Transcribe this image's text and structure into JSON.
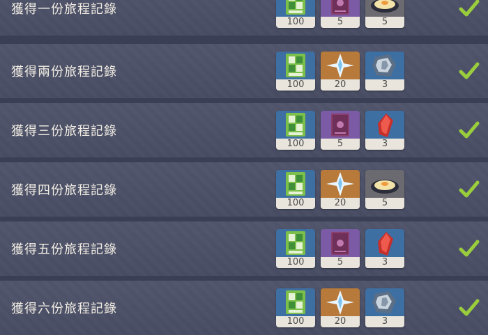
{
  "rows": [
    {
      "title": "獲得一份旅程記錄",
      "completed": true,
      "rewards": [
        {
          "icon": "battle-pass-exp-icon",
          "count": "100"
        },
        {
          "icon": "heros-wit-book-icon",
          "count": "5"
        },
        {
          "icon": "fragile-resin-plate-icon",
          "count": "5"
        }
      ]
    },
    {
      "title": "獲得兩份旅程記錄",
      "completed": true,
      "rewards": [
        {
          "icon": "battle-pass-exp-icon",
          "count": "100"
        },
        {
          "icon": "primogem-icon",
          "count": "20"
        },
        {
          "icon": "mystic-enhancement-ore-icon",
          "count": "3"
        }
      ]
    },
    {
      "title": "獲得三份旅程記錄",
      "completed": true,
      "rewards": [
        {
          "icon": "battle-pass-exp-icon",
          "count": "100"
        },
        {
          "icon": "heros-wit-book-icon",
          "count": "5"
        },
        {
          "icon": "red-crystal-material-icon",
          "count": "3"
        }
      ]
    },
    {
      "title": "獲得四份旅程記錄",
      "completed": true,
      "rewards": [
        {
          "icon": "battle-pass-exp-icon",
          "count": "100"
        },
        {
          "icon": "primogem-icon",
          "count": "20"
        },
        {
          "icon": "fragile-resin-plate-icon",
          "count": "5"
        }
      ]
    },
    {
      "title": "獲得五份旅程記錄",
      "completed": true,
      "rewards": [
        {
          "icon": "battle-pass-exp-icon",
          "count": "100"
        },
        {
          "icon": "heros-wit-book-icon",
          "count": "5"
        },
        {
          "icon": "red-crystal-material-icon",
          "count": "3"
        }
      ]
    },
    {
      "title": "獲得六份旅程記錄",
      "completed": true,
      "rewards": [
        {
          "icon": "battle-pass-exp-icon",
          "count": "100"
        },
        {
          "icon": "primogem-icon",
          "count": "20"
        },
        {
          "icon": "mystic-enhancement-ore-icon",
          "count": "3"
        }
      ]
    }
  ],
  "colors": {
    "background": "#3a3f55",
    "row": "#4a4f66",
    "text": "#f2ede4",
    "check": "#9acd3c",
    "rarity_blue": "#3e6fa3",
    "rarity_purple": "#7b5aa6",
    "rarity_gold": "#b87a3a",
    "rarity_gray": "#6b6a70",
    "count_bg": "#e9e5dc"
  }
}
